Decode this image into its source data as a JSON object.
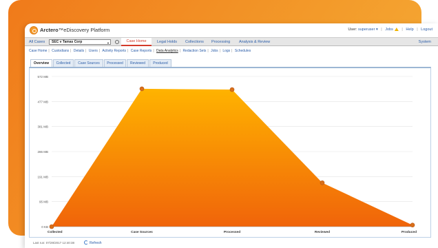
{
  "app": {
    "brand_prefix": "Arctero",
    "brand_suffix": "™eDiscovery Platform",
    "user_label": "User:",
    "user_name": "superuser ▾",
    "jobs": "Jobs",
    "help": "Help",
    "logout": "Logout"
  },
  "nav": {
    "all_cases": "All Cases",
    "case_value": "SEC v Tamas Corp",
    "items": [
      "Case Home",
      "Legal Holds",
      "Collections",
      "Processing",
      "Analysis & Review"
    ],
    "active": "Case Home",
    "right_item": "System"
  },
  "subnav": {
    "items": [
      "Case Home",
      "Custodians",
      "Details",
      "Users",
      "Activity Reports",
      "Case Reports",
      "Data Analytics",
      "Redaction Sets",
      "Jobs",
      "Logs",
      "Schedules"
    ],
    "active": "Data Analytics"
  },
  "tabs": [
    "Overview",
    "Collected",
    "Case Sources",
    "Processed",
    "Reviewed",
    "Produced"
  ],
  "active_tab": "Overview",
  "chart_data": {
    "type": "area",
    "categories": [
      "Collected",
      "Case Sources",
      "Processed",
      "Reviewed",
      "Produced"
    ],
    "values": [
      0,
      525,
      522,
      167,
      6
    ],
    "y_ticks": [
      "0 KB",
      "95 MB",
      "191 MB",
      "286 MB",
      "381 MB",
      "477 MB",
      "572 MB"
    ],
    "ylim": [
      0,
      572
    ],
    "fill_top": "#ffb300",
    "fill_bottom": "#f0640a",
    "point_color": "#d9701a",
    "grid": true
  },
  "footer": {
    "last_run": "Last run: 07/29/2017 12:40:38",
    "refresh": "Refresh"
  }
}
